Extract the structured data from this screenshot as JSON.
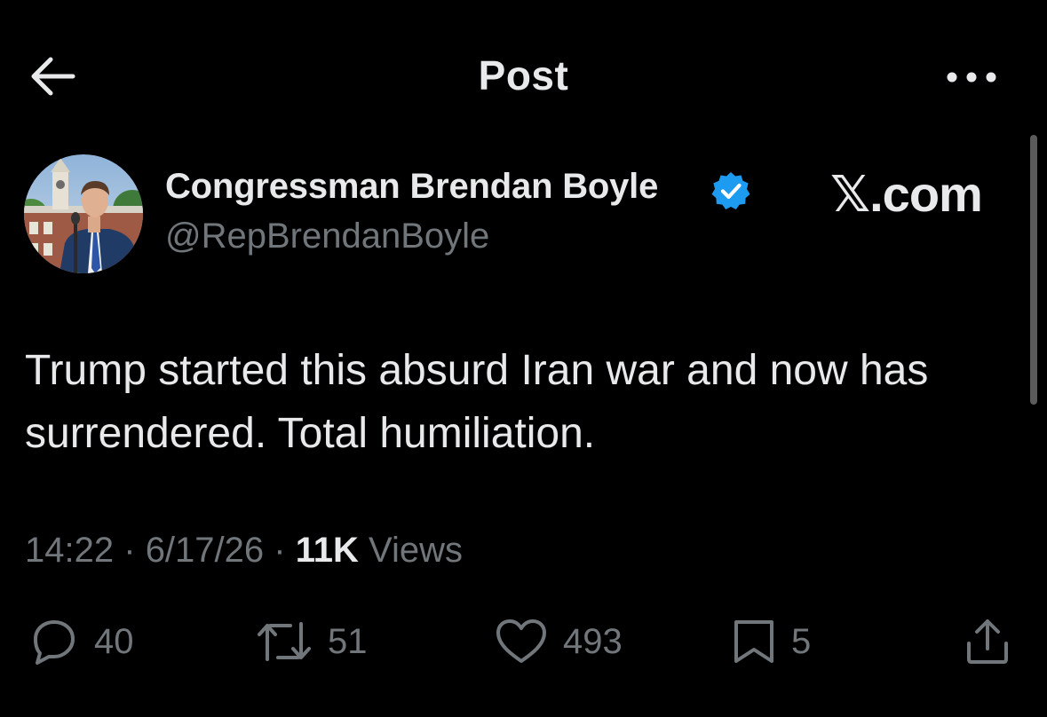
{
  "header": {
    "title": "Post"
  },
  "author": {
    "display_name": "Congressman Brendan Boyle",
    "handle": "@RepBrendanBoyle",
    "verified": true,
    "verified_color": "#1d9bf0"
  },
  "watermark": "𝕏.com",
  "post": {
    "text": "Trump started this absurd Iran war and now has surrendered. Total humiliation."
  },
  "meta": {
    "time": "14:22",
    "date": "6/17/26",
    "views_count": "11K",
    "views_label": "Views",
    "separator": "·"
  },
  "actions": {
    "replies": "40",
    "reposts": "51",
    "likes": "493",
    "bookmarks": "5"
  },
  "icons": {
    "back": "arrow-left-icon",
    "more": "more-horizontal-icon",
    "reply": "reply-icon",
    "repost": "repost-icon",
    "like": "heart-icon",
    "bookmark": "bookmark-icon",
    "share": "share-icon"
  },
  "colors": {
    "background": "#000000",
    "text_primary": "#e7e9ea",
    "text_secondary": "#71767b"
  }
}
